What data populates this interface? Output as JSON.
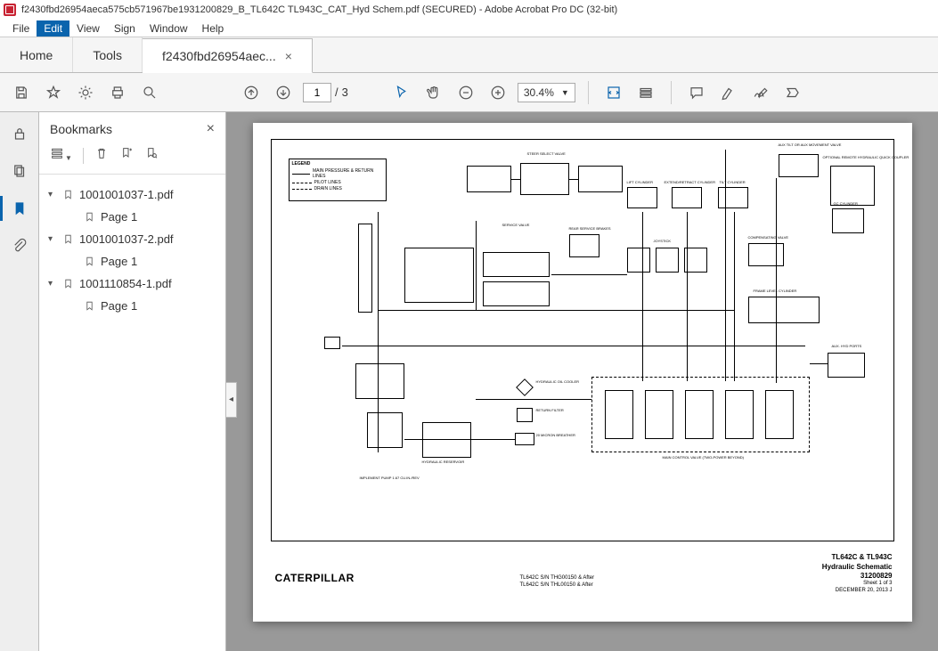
{
  "title": "f2430fbd26954aeca575cb571967be1931200829_B_TL642C TL943C_CAT_Hyd Schem.pdf (SECURED) - Adobe Acrobat Pro DC (32-bit)",
  "menu": {
    "file": "File",
    "edit": "Edit",
    "view": "View",
    "sign": "Sign",
    "window": "Window",
    "help": "Help"
  },
  "tabs": {
    "home": "Home",
    "tools": "Tools",
    "doc": "f2430fbd26954aec..."
  },
  "toolbar": {
    "page_current": "1",
    "page_total": "3",
    "page_sep": "/",
    "zoom": "30.4%"
  },
  "bookmarks": {
    "title": "Bookmarks",
    "items": [
      {
        "label": "1001001037-1.pdf",
        "children": [
          {
            "label": "Page 1"
          }
        ]
      },
      {
        "label": "1001001037-2.pdf",
        "children": [
          {
            "label": "Page 1"
          }
        ]
      },
      {
        "label": "1001110854-1.pdf",
        "children": [
          {
            "label": "Page 1"
          }
        ]
      }
    ]
  },
  "doc": {
    "legend": {
      "title": "LEGEND",
      "rows": [
        "MAIN PRESSURE & RETURN LINES",
        "PILOT LINES",
        "DRAIN LINES"
      ]
    },
    "labels": {
      "steer_select": "STEER SELECT\nVALVE",
      "aux_top": "AUX TILT OR AUX\nMOVEMENT VALVE",
      "optional": "OPTIONAL REMOTE\nHYDRAULIC QUICK COUPLER",
      "lift": "LIFT CYLINDER",
      "extend": "EXTEND/RETRACT CYLINDER",
      "tilt": "TILT CYLINDER",
      "gc": "GC CYLINDER",
      "service": "SERVICE\nVALVE",
      "rear": "REAR\nSERVICE\nBRAKES",
      "joystick": "JOYSTICK",
      "compensate": "COMPENSATING\nVALVE",
      "frame": "FRAME LEVEL CYLINDER",
      "hyd_cooler": "HYDRAULIC\nOIL COOLER",
      "return_filter": "RETURN\nFILTER",
      "breather": "20 MICRON\nBREATHER",
      "main_valve": "MAIN\nCONTROL VALVE\n(TWO-POWER BEYOND)",
      "reservoir": "HYDRAULIC\nRESERVOIR",
      "pump": "IMPLEMENT PUMP\n1.67 CU.IN./REV",
      "aux_ports": "AUX. HYD\nPORTS"
    },
    "brand": "CATERPILLAR",
    "foot_mid": {
      "l1": "TL642C S/N THG00150 & After",
      "l2": "TL642C S/N THL00150 & After"
    },
    "foot_right": {
      "model": "TL642C & TL943C",
      "title": "Hydraulic Schematic",
      "num": "31200829",
      "sheet": "Sheet 1 of 3",
      "date": "DECEMBER 20, 2013   J"
    }
  }
}
